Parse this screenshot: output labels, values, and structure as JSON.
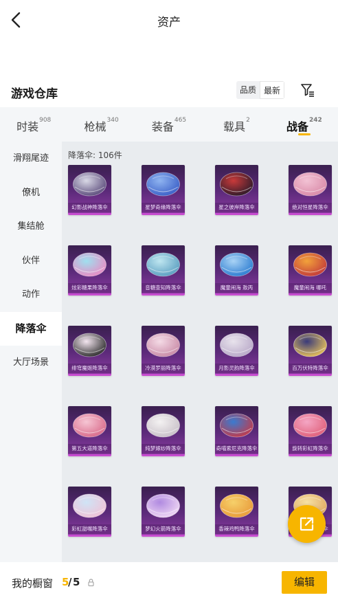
{
  "header": {
    "title": "资产"
  },
  "warehouse": {
    "title": "游戏仓库",
    "sort_options": [
      "品质",
      "最新"
    ],
    "active_sort": 1
  },
  "categories": [
    {
      "label": "时装",
      "count": "908"
    },
    {
      "label": "枪械",
      "count": "340"
    },
    {
      "label": "装备",
      "count": "465"
    },
    {
      "label": "载具",
      "count": "2"
    },
    {
      "label": "战备",
      "count": "242"
    }
  ],
  "active_category": 4,
  "sidebar": {
    "items": [
      "滑翔尾迹",
      "僚机",
      "集结舱",
      "伙伴",
      "动作",
      "降落伞",
      "大厅场景"
    ],
    "active_index": 5
  },
  "content": {
    "count_label": "降落伞: 106件"
  },
  "items": [
    {
      "name": "幻影战神降落伞",
      "colors": [
        "#d9d9e6",
        "#5a4a7a"
      ]
    },
    {
      "name": "星梦奇缘降落伞",
      "colors": [
        "#8fb4f0",
        "#3a5fc7"
      ]
    },
    {
      "name": "星之彼岸降落伞",
      "colors": [
        "#c93a3a",
        "#2a1a2a"
      ]
    },
    {
      "name": "绝对恒星降落伞",
      "colors": [
        "#f2c2d4",
        "#d98aa8"
      ]
    },
    {
      "name": "炫彩糖果降落伞",
      "colors": [
        "#9fe0ef",
        "#e98bc4"
      ]
    },
    {
      "name": "音糖查知降落伞",
      "colors": [
        "#bfe6f0",
        "#5a9ec0"
      ]
    },
    {
      "name": "魔童闹海 敖丙",
      "colors": [
        "#a9d3f5",
        "#2a7bd0"
      ]
    },
    {
      "name": "魔童闹海 哪吒",
      "colors": [
        "#f2a23a",
        "#c23a3a"
      ]
    },
    {
      "name": "绯穹魔姬降落伞",
      "colors": [
        "#f4e6f0",
        "#2a2a2a"
      ]
    },
    {
      "name": "冷漠罗丽降落伞",
      "colors": [
        "#f4dbe6",
        "#c98aa6"
      ]
    },
    {
      "name": "月影灵韵降落伞",
      "colors": [
        "#e8e3ec",
        "#b8a8c8"
      ]
    },
    {
      "name": "百万伏特降落伞",
      "colors": [
        "#3a3a7a",
        "#e8c35a"
      ]
    },
    {
      "name": "第五大道降落伞",
      "colors": [
        "#f6c6d4",
        "#d96a8a"
      ]
    },
    {
      "name": "纯梦嫁纱降落伞",
      "colors": [
        "#f4f2f2",
        "#c8c0c8"
      ]
    },
    {
      "name": "奇喵索尼克降落伞",
      "colors": [
        "#3a7bd0",
        "#c33a4a"
      ]
    },
    {
      "name": "旋转彩虹降落伞",
      "colors": [
        "#f4a6c4",
        "#e0607a"
      ]
    },
    {
      "name": "彩虹甜嘴降落伞",
      "colors": [
        "#cfe4f6",
        "#f0c2d6"
      ]
    },
    {
      "name": "梦幻火箭降落伞",
      "colors": [
        "#b08ae0",
        "#f0d8f4"
      ]
    },
    {
      "name": "香辣鸡鸭降落伞",
      "colors": [
        "#f6d06a",
        "#e89a3a"
      ]
    },
    {
      "name": "迷你星球降落伞",
      "colors": [
        "#f6e2a6",
        "#e0a860"
      ]
    }
  ],
  "bottom": {
    "showcase_label": "我的橱窗",
    "used": "5",
    "separator": "/",
    "total": "5",
    "edit_label": "编辑"
  },
  "colors": {
    "accent": "#f7b500",
    "card_border": "#c64ccf",
    "panel_bg": "#f4f6f8"
  },
  "icons": {
    "back": "chevron-left-icon",
    "filter": "filter-icon",
    "share": "share-icon",
    "lock": "lock-icon"
  }
}
